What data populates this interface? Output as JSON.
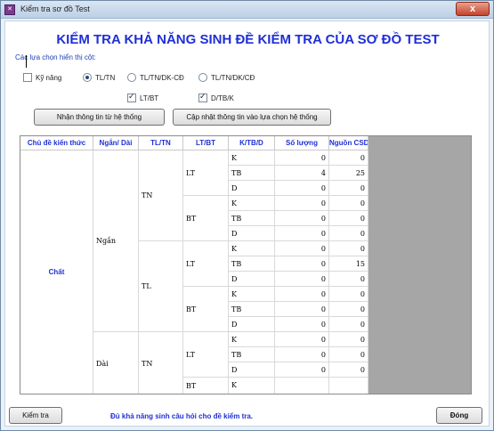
{
  "window": {
    "title": "Kiểm tra sơ đồ Test",
    "close_label": "x"
  },
  "header": {
    "title": "KIỂM TRA KHẢ NĂNG SINH ĐỀ KIỂM TRA CỦA SƠ ĐỒ TEST",
    "options_label": "Các lựa chọn hiển thị cột:"
  },
  "options": {
    "ky_nang": {
      "label": "Kỹ năng",
      "checked": false
    },
    "radio_tltn": {
      "label": "TL/TN",
      "checked": true
    },
    "radio_tltn_dkcd": {
      "label": "TL/TN/DK-CĐ",
      "checked": false
    },
    "radio_tltn_dkcd2": {
      "label": "TL/TN/DK/CĐ",
      "checked": false
    },
    "lt_bt": {
      "label": "LT/BT",
      "checked": true
    },
    "d_tb_k": {
      "label": "D/TB/K",
      "checked": true
    }
  },
  "buttons": {
    "fetch": "Nhận thông tin từ hệ thống",
    "update": "Cập nhật thông tin vào lựa chọn hệ thống",
    "check": "Kiểm tra",
    "close": "Đóng"
  },
  "table": {
    "columns": [
      "Chủ đề kiến thức",
      "Ngắn/ Dài",
      "TL/TN",
      "LT/BT",
      "K/TB/D",
      "Số lượng",
      "Nguồn CSDL"
    ],
    "groups": {
      "chude": "Chất",
      "ngan": "Ngắn",
      "dai": "Dài",
      "tn1": "TN",
      "tl1": "TL",
      "tn2": "TN",
      "lt1": "LT",
      "bt1": "BT",
      "lt2": "LT",
      "bt2": "BT",
      "lt3": "LT",
      "bt3": "BT"
    },
    "rows": [
      {
        "level": "K",
        "count": "0",
        "source": "0"
      },
      {
        "level": "TB",
        "count": "4",
        "source": "25"
      },
      {
        "level": "D",
        "count": "0",
        "source": "0"
      },
      {
        "level": "K",
        "count": "0",
        "source": "0"
      },
      {
        "level": "TB",
        "count": "0",
        "source": "0"
      },
      {
        "level": "D",
        "count": "0",
        "source": "0"
      },
      {
        "level": "K",
        "count": "0",
        "source": "0"
      },
      {
        "level": "TB",
        "count": "0",
        "source": "15"
      },
      {
        "level": "D",
        "count": "0",
        "source": "0"
      },
      {
        "level": "K",
        "count": "0",
        "source": "0"
      },
      {
        "level": "TB",
        "count": "0",
        "source": "0"
      },
      {
        "level": "D",
        "count": "0",
        "source": "0"
      },
      {
        "level": "K",
        "count": "0",
        "source": "0"
      },
      {
        "level": "TB",
        "count": "0",
        "source": "0"
      },
      {
        "level": "D",
        "count": "0",
        "source": "0"
      },
      {
        "level": "K",
        "count": "",
        "source": ""
      }
    ]
  },
  "status": "Đủ khả năng sinh câu hỏi cho đề kiểm tra."
}
